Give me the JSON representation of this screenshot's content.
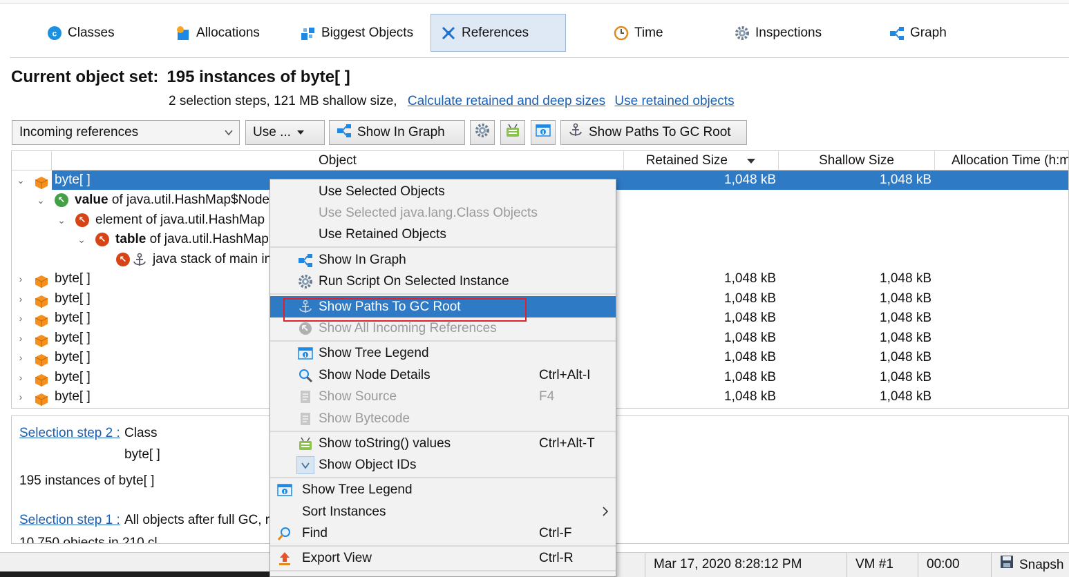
{
  "tabs": [
    {
      "label": "Classes",
      "icon": "classes-icon"
    },
    {
      "label": "Allocations",
      "icon": "allocations-icon"
    },
    {
      "label": "Biggest Objects",
      "icon": "biggest-objects-icon"
    },
    {
      "label": "References",
      "icon": "references-icon",
      "active": true
    },
    {
      "label": "Time",
      "icon": "clock-icon"
    },
    {
      "label": "Inspections",
      "icon": "gear-icon"
    },
    {
      "label": "Graph",
      "icon": "graph-icon"
    }
  ],
  "header": {
    "title_prefix": "Current object set:",
    "title_count": "195 instances of byte[ ]",
    "summary": "2 selection steps, 121 MB shallow size,",
    "link_calculate": "Calculate retained and deep sizes",
    "link_use_retained": "Use retained objects"
  },
  "toolbar": {
    "reference_mode": "Incoming references",
    "use_button": "Use ...",
    "show_in_graph": "Show In Graph",
    "show_paths": "Show Paths To GC Root"
  },
  "table": {
    "columns": [
      "Object",
      "Retained Size",
      "Shallow Size",
      "Allocation Time (h:m"
    ],
    "selected_row": {
      "label": "byte[ ]",
      "retained": "1,048 kB",
      "shallow": "1,048 kB"
    },
    "tree": {
      "value_bold": "value",
      "value_rest": " of java.util.HashMap$Node",
      "element": "element of java.util.HashMap",
      "table_bold": "table",
      "table_rest": " of java.util.HashMap",
      "root": "java stack of main in"
    },
    "rows": [
      {
        "label": "byte[ ]",
        "retained": "1,048 kB",
        "shallow": "1,048 kB"
      },
      {
        "label": "byte[ ]",
        "retained": "1,048 kB",
        "shallow": "1,048 kB"
      },
      {
        "label": "byte[ ]",
        "retained": "1,048 kB",
        "shallow": "1,048 kB"
      },
      {
        "label": "byte[ ]",
        "retained": "1,048 kB",
        "shallow": "1,048 kB"
      },
      {
        "label": "byte[ ]",
        "retained": "1,048 kB",
        "shallow": "1,048 kB"
      },
      {
        "label": "byte[ ]",
        "retained": "1,048 kB",
        "shallow": "1,048 kB"
      },
      {
        "label": "byte[ ]",
        "retained": "1,048 kB",
        "shallow": "1,048 kB"
      }
    ]
  },
  "bottom_panel": {
    "step2_link": "Selection step 2 :",
    "step2_kind": "Class",
    "step2_class": "byte[ ]",
    "step2_result": "195 instances of byte[ ]",
    "step1_link": "Selection step 1 :",
    "step1_desc": "All objects after full GC, r",
    "step1_result": "10,750 objects in 210 cl"
  },
  "status_bar": {
    "datetime": "Mar 17, 2020 8:28:12 PM",
    "vm": "VM #1",
    "time": "00:00",
    "snapshot": "Snapsh"
  },
  "context_menu": {
    "use_selected": "Use Selected Objects",
    "use_selected_class": "Use Selected java.lang.Class Objects",
    "use_retained": "Use Retained Objects",
    "show_in_graph": "Show In Graph",
    "run_script": "Run Script On Selected Instance",
    "show_paths": "Show Paths To GC Root",
    "show_incoming": "Show All Incoming References",
    "show_tree_legend": "Show Tree Legend",
    "show_node_details": "Show Node Details",
    "show_node_details_sc": "Ctrl+Alt-I",
    "show_source": "Show Source",
    "show_source_sc": "F4",
    "show_bytecode": "Show Bytecode",
    "show_tostring": "Show toString() values",
    "show_tostring_sc": "Ctrl+Alt-T",
    "show_object_ids": "Show Object IDs",
    "show_tree_legend2": "Show Tree Legend",
    "sort_instances": "Sort Instances",
    "find": "Find",
    "find_sc": "Ctrl-F",
    "export_view": "Export View",
    "export_view_sc": "Ctrl-R"
  },
  "colors": {
    "selection": "#2f7ac5",
    "link": "#1a5fb4",
    "highlight_box": "#e0202a",
    "cube": "#f5901e"
  }
}
